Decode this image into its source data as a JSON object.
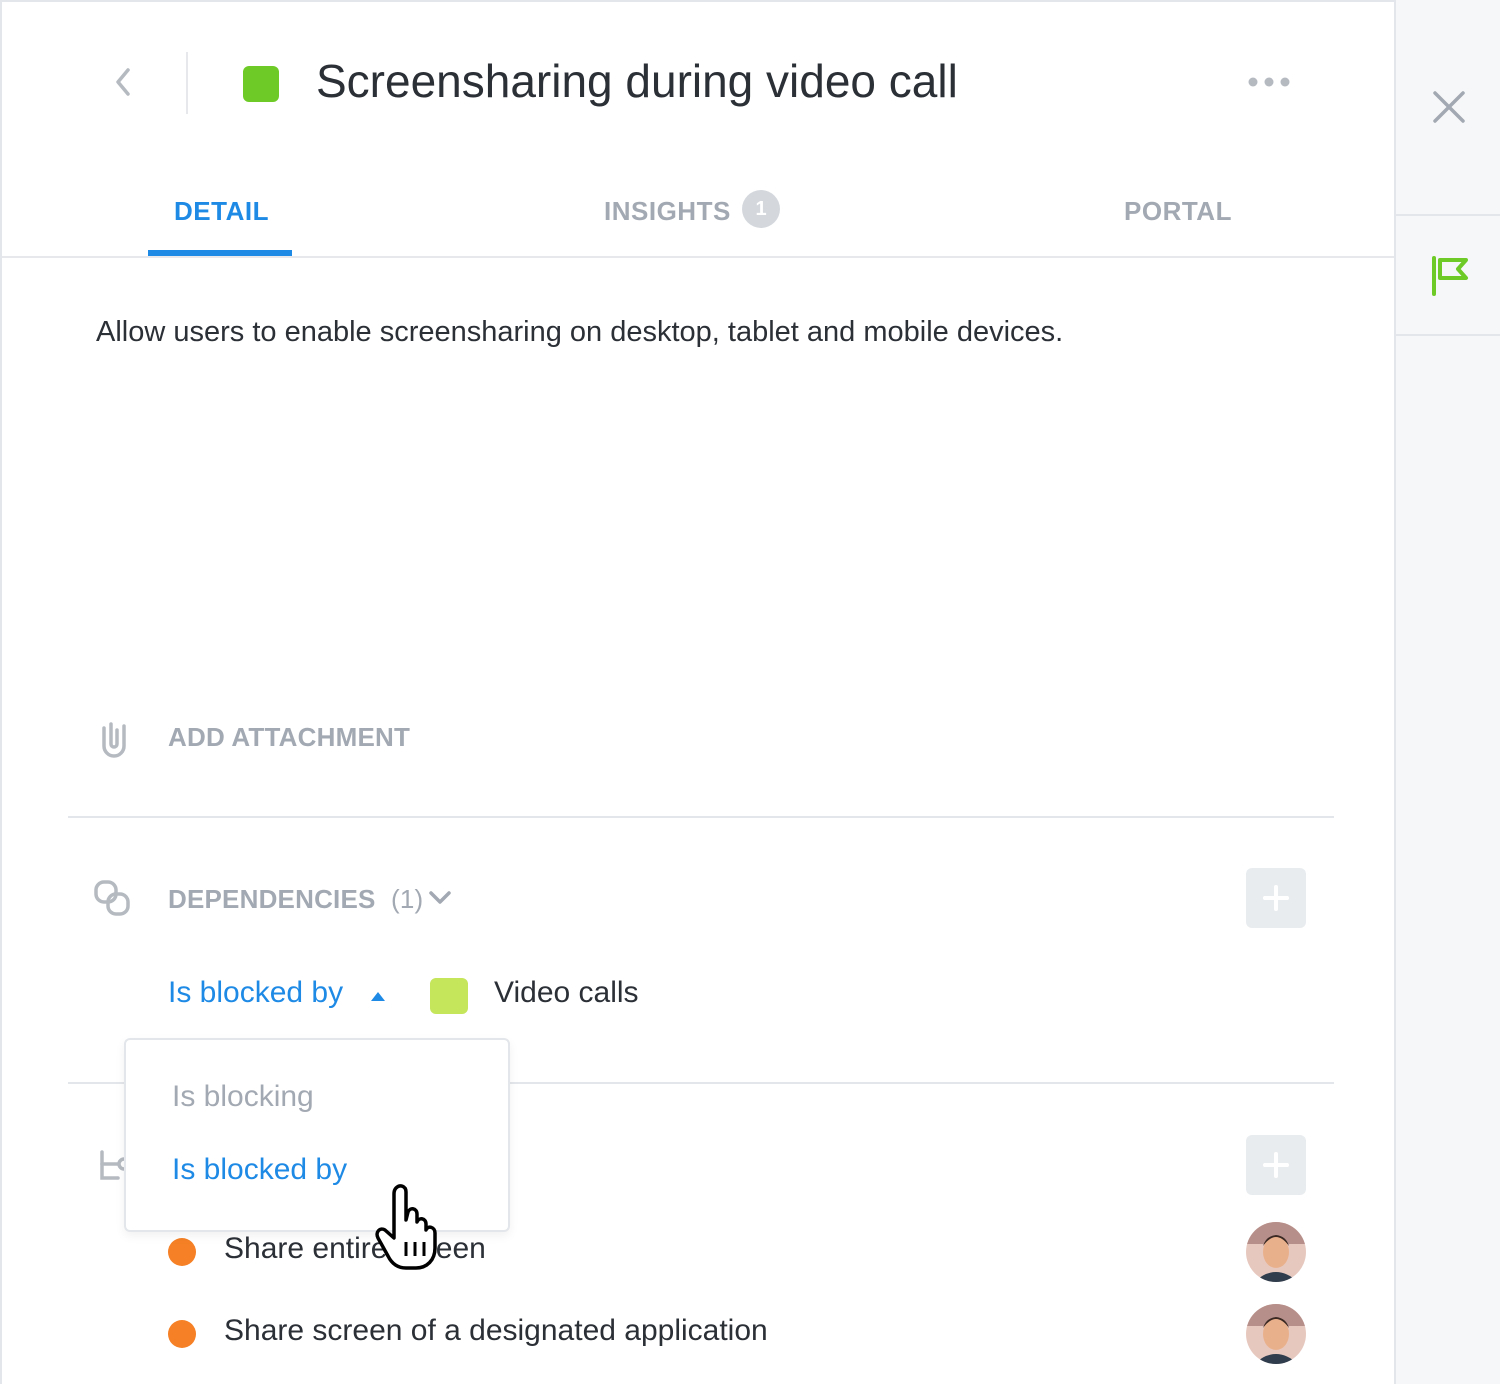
{
  "header": {
    "title": "Screensharing during video call",
    "status_color": "#6ecb27"
  },
  "tabs": [
    {
      "label": "DETAIL",
      "active": true
    },
    {
      "label": "INSIGHTS",
      "badge": "1",
      "active": false
    },
    {
      "label": "PORTAL",
      "active": false
    }
  ],
  "description": "Allow users to enable screensharing on desktop, tablet and mobile devices.",
  "attachments": {
    "label": "ADD ATTACHMENT"
  },
  "dependencies": {
    "label": "DEPENDENCIES",
    "count": "(1)",
    "relation_label": "Is blocked by",
    "item": {
      "name": "Video calls",
      "color": "#c5e55a"
    }
  },
  "relation_dropdown": {
    "options": [
      "Is blocking",
      "Is blocked by"
    ],
    "selected": "Is blocked by"
  },
  "subitems": [
    {
      "name": "Share entire screen",
      "status_color": "#f58025"
    },
    {
      "name": "Share screen of a designated application",
      "status_color": "#f58025"
    }
  ],
  "colors": {
    "accent": "#1e8ae6",
    "muted": "#a3a9b2",
    "flag": "#6ecb27"
  },
  "icons": {
    "back": "chevron-left-icon",
    "more": "more-horizontal-icon",
    "close": "close-icon",
    "flag": "flag-icon",
    "attachment": "paperclip-icon",
    "dependencies": "link-icon",
    "subitems": "hierarchy-icon",
    "expand": "chevron-down-icon",
    "relation_toggle": "caret-up-icon",
    "add": "plus-icon",
    "cursor": "hand-pointer-icon"
  }
}
